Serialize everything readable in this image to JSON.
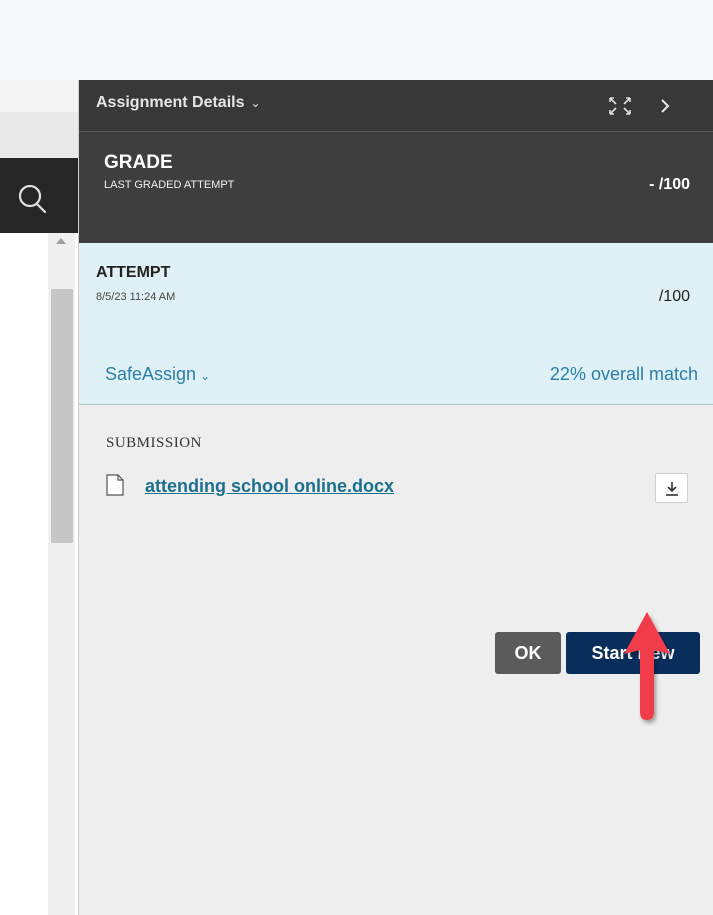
{
  "panel": {
    "header_title": "Assignment Details",
    "header_chevron": "⌄",
    "expand_icon": "expand-icon",
    "collapse_icon": "chevron-right-icon"
  },
  "grade": {
    "label": "GRADE",
    "sublabel": "LAST GRADED ATTEMPT",
    "value": "- /100"
  },
  "attempt": {
    "label": "ATTEMPT",
    "date": "8/5/23 11:24 AM",
    "value": "/100"
  },
  "safeassign": {
    "label": "SafeAssign",
    "chevron": "⌄",
    "match": "22% overall match"
  },
  "submission": {
    "label": "SUBMISSION",
    "file_name": "attending school online.docx"
  },
  "actions": {
    "ok_label": "OK",
    "start_new_label": "Start New"
  },
  "colors": {
    "header_bg": "#383838",
    "grade_bg": "#3e3e3e",
    "attempt_bg": "#dff1f6",
    "link": "#1b6f8f",
    "accent_blue": "#0a2e5c",
    "arrow_red": "#f03c48"
  }
}
